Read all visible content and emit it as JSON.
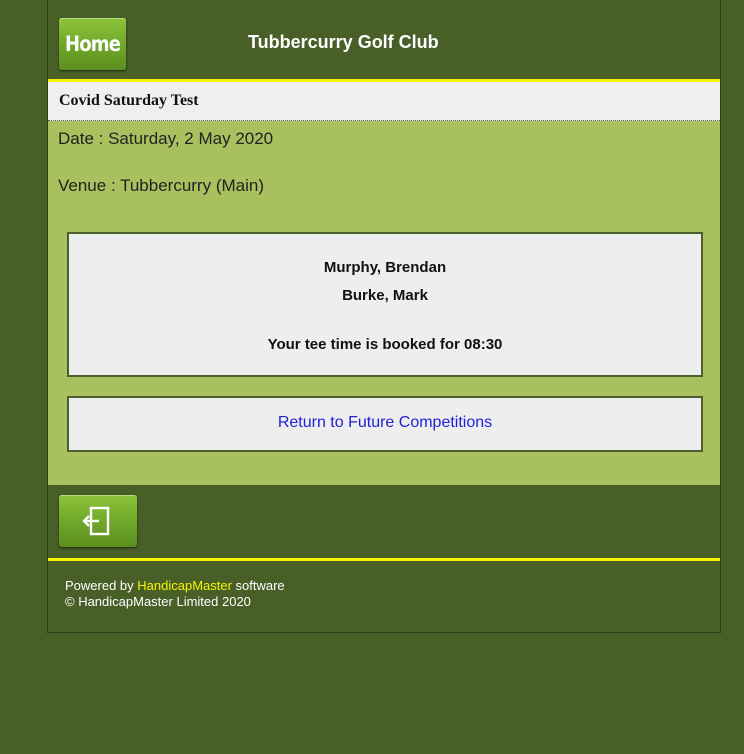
{
  "header": {
    "home_label": "Home",
    "club_name": "Tubbercurry Golf Club"
  },
  "competition": {
    "name": "Covid Saturday Test",
    "date_line": "Date : Saturday, 2 May 2020",
    "venue_line": "Venue : Tubbercurry (Main)"
  },
  "booking": {
    "players": [
      "Murphy, Brendan",
      "Burke, Mark"
    ],
    "tee_time_text": "Your tee time is booked for 08:30"
  },
  "return_link": "Return to Future Competitions",
  "logout_icon": "logout-icon",
  "footer": {
    "powered_prefix": "Powered by ",
    "brand": "HandicapMaster",
    "powered_suffix": " software",
    "copyright": "© HandicapMaster Limited 2020"
  },
  "colors": {
    "background": "#485f28",
    "content": "#a8c05e",
    "accent_line": "#f5f500",
    "button": "#6ea629",
    "link": "#1f1fd6"
  }
}
